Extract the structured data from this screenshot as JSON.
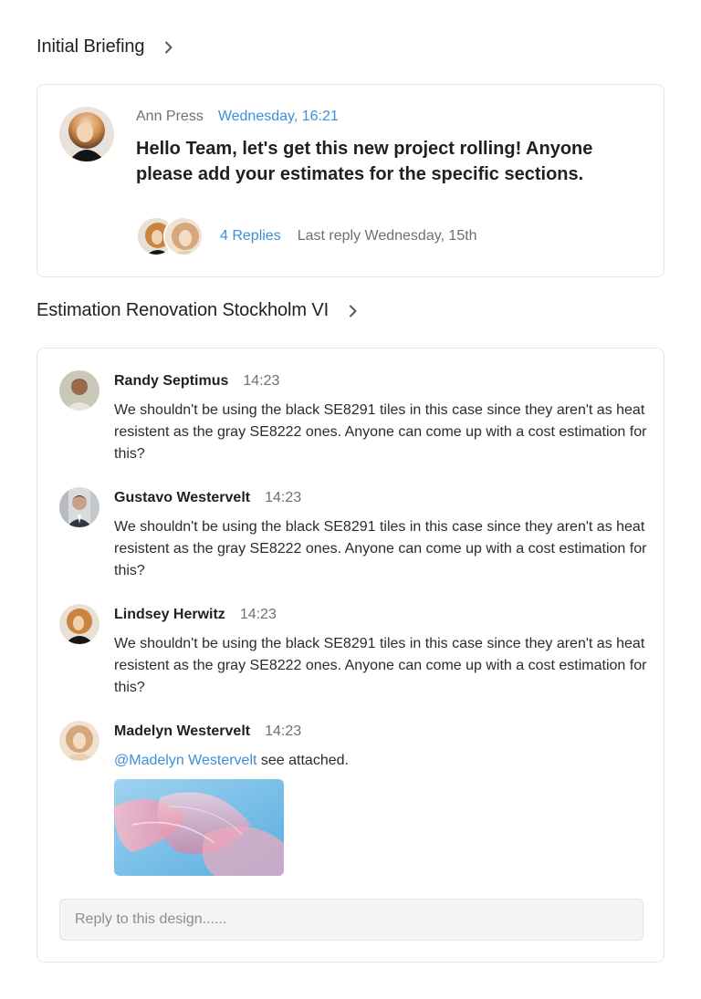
{
  "briefing": {
    "title": "Initial Briefing",
    "author": "Ann Press",
    "time": "Wednesday, 16:21",
    "message": "Hello Team, let's get this new project rolling! Anyone please add your estimates for the specific sections.",
    "replies_label": "4 Replies",
    "last_reply": "Last reply Wednesday, 15th"
  },
  "thread": {
    "title": "Estimation Renovation Stockholm VI",
    "comments": [
      {
        "name": "Randy Septimus",
        "time": "14:23",
        "text": "We shouldn't be using the black SE8291 tiles in this case since they aren't as heat resistent as the gray SE8222 ones. Anyone can come up with a cost estimation for this?"
      },
      {
        "name": "Gustavo Westervelt",
        "time": "14:23",
        "text": "We shouldn't be using the black SE8291 tiles in this case since they aren't as heat resistent as the gray SE8222 ones. Anyone can come up with a cost estimation for this?"
      },
      {
        "name": "Lindsey Herwitz",
        "time": "14:23",
        "text": "We shouldn't be using the black SE8291 tiles in this case since they aren't as heat resistent as the gray SE8222 ones. Anyone can come up with a cost estimation for this?"
      },
      {
        "name": "Madelyn Westervelt",
        "time": "14:23",
        "mention": "@Madelyn Westervelt",
        "text": " see attached."
      }
    ],
    "reply_placeholder": "Reply to this design......"
  },
  "colors": {
    "accent": "#3d8fd8",
    "muted": "#6b6f76",
    "border": "#e6e6e8"
  },
  "icons": [
    "chevron-right-icon"
  ]
}
